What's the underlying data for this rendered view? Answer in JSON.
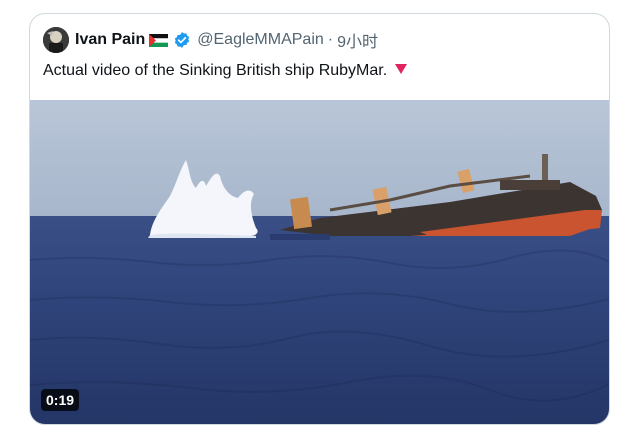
{
  "tweet": {
    "author_name": "Ivan Pain",
    "author_handle": "@EagleMMAPain",
    "separator": "·",
    "time": "9小时",
    "text": "Actual video of the Sinking British ship RubyMar.",
    "flag_icon": "palestine-flag-icon",
    "verified_icon": "verified-badge-icon",
    "emoji_icon": "red-triangle-down-icon"
  },
  "media": {
    "duration": "0:19"
  },
  "colors": {
    "border": "#cfd9de",
    "handle_gray": "#536471",
    "verified_blue": "#1d9bf0",
    "sea": "#2b3d70",
    "hull_red": "#c9542f"
  }
}
